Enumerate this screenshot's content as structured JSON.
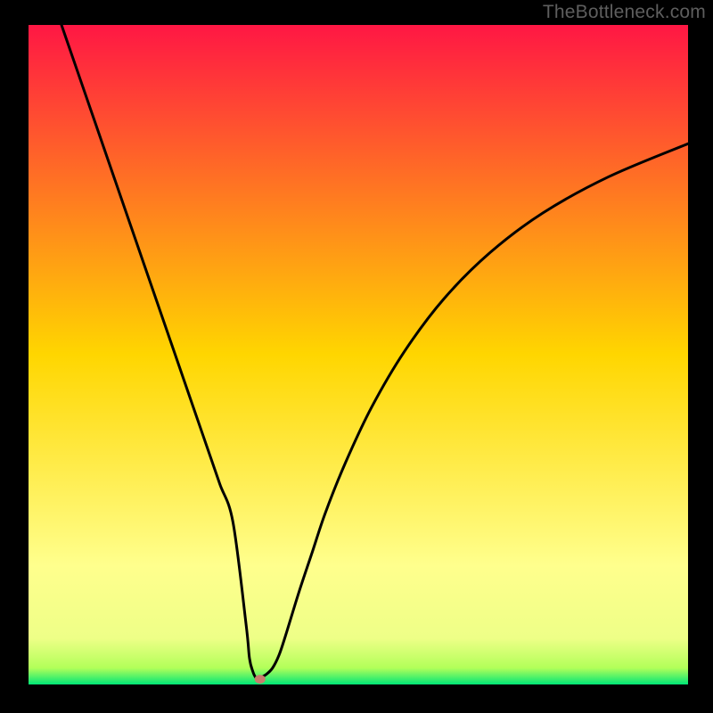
{
  "watermark": "TheBottleneck.com",
  "chart_data": {
    "type": "line",
    "title": "",
    "xlabel": "",
    "ylabel": "",
    "xlim": [
      0,
      100
    ],
    "ylim": [
      0,
      100
    ],
    "grid": false,
    "legend": false,
    "background_gradient": {
      "stops": [
        {
          "offset": 0.0,
          "color": "#ff1744"
        },
        {
          "offset": 0.5,
          "color": "#ffd600"
        },
        {
          "offset": 0.82,
          "color": "#ffff8d"
        },
        {
          "offset": 0.93,
          "color": "#eeff87"
        },
        {
          "offset": 0.975,
          "color": "#b2ff59"
        },
        {
          "offset": 1.0,
          "color": "#00e676"
        }
      ]
    },
    "series": [
      {
        "name": "bottleneck-curve",
        "color": "#000000",
        "x": [
          5,
          10,
          15,
          20,
          25,
          27,
          29,
          31,
          33,
          33.5,
          34,
          34.5,
          35,
          36,
          37,
          38,
          39,
          41,
          43,
          45,
          48,
          52,
          57,
          63,
          70,
          78,
          88,
          100
        ],
        "y": [
          100,
          85.5,
          71,
          56.5,
          42,
          36.2,
          30.4,
          24.6,
          9,
          4,
          2,
          1,
          1,
          1.5,
          2.5,
          4.5,
          7.5,
          14,
          20,
          26,
          33.5,
          42,
          50.5,
          58.5,
          65.5,
          71.5,
          77,
          82
        ]
      }
    ],
    "points": [
      {
        "name": "marker-dot",
        "x": 35.1,
        "y": 0.8,
        "color": "#c97c6d",
        "rx": 6,
        "ry": 5
      }
    ],
    "annotations": []
  }
}
